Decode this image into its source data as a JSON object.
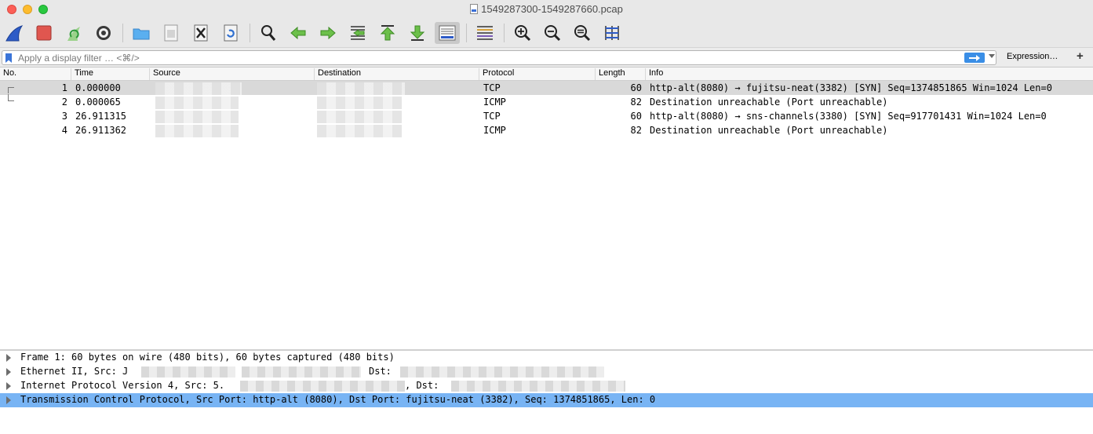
{
  "window": {
    "title": "1549287300-1549287660.pcap"
  },
  "toolbar": {
    "buttons": [
      {
        "icon": "shark-fin-icon",
        "label": "Start capture"
      },
      {
        "icon": "stop-icon",
        "label": "Stop capture"
      },
      {
        "icon": "restart-icon",
        "label": "Restart capture"
      },
      {
        "icon": "gear-icon",
        "label": "Capture options"
      },
      {
        "icon": "folder-icon",
        "label": "Open"
      },
      {
        "icon": "save-icon",
        "label": "Save"
      },
      {
        "icon": "close-file-icon",
        "label": "Close"
      },
      {
        "icon": "reload-icon",
        "label": "Reload"
      },
      {
        "icon": "search-icon",
        "label": "Find packet"
      },
      {
        "icon": "arrow-left-icon",
        "label": "Go back"
      },
      {
        "icon": "arrow-right-icon",
        "label": "Go forward"
      },
      {
        "icon": "go-to-packet-icon",
        "label": "Go to packet"
      },
      {
        "icon": "first-packet-icon",
        "label": "First packet"
      },
      {
        "icon": "last-packet-icon",
        "label": "Last packet"
      },
      {
        "icon": "autoscroll-icon",
        "label": "Auto scroll"
      },
      {
        "icon": "colorize-icon",
        "label": "Colorize"
      },
      {
        "icon": "zoom-in-icon",
        "label": "Zoom in"
      },
      {
        "icon": "zoom-out-icon",
        "label": "Zoom out"
      },
      {
        "icon": "zoom-reset-icon",
        "label": "Normal size"
      },
      {
        "icon": "resize-columns-icon",
        "label": "Resize columns"
      }
    ]
  },
  "filter": {
    "placeholder": "Apply a display filter … <⌘/>",
    "value": "",
    "apply_icon": "arrow-right-icon",
    "expression_label": "Expression…",
    "add_label": "+"
  },
  "packet_list": {
    "columns": [
      "No.",
      "Time",
      "Source",
      "Destination",
      "Protocol",
      "Length",
      "Info"
    ],
    "rows": [
      {
        "no": "1",
        "time": "0.000000",
        "protocol": "TCP",
        "length": "60",
        "info": "http-alt(8080) → fujitsu-neat(3382) [SYN] Seq=1374851865 Win=1024 Len=0",
        "selected": true
      },
      {
        "no": "2",
        "time": "0.000065",
        "protocol": "ICMP",
        "length": "82",
        "info": "Destination unreachable (Port unreachable)",
        "selected": false
      },
      {
        "no": "3",
        "time": "26.911315",
        "protocol": "TCP",
        "length": "60",
        "info": "http-alt(8080) → sns-channels(3380) [SYN] Seq=917701431 Win=1024 Len=0",
        "selected": false
      },
      {
        "no": "4",
        "time": "26.911362",
        "protocol": "ICMP",
        "length": "82",
        "info": "Destination unreachable (Port unreachable)",
        "selected": false
      }
    ]
  },
  "details": {
    "rows": [
      {
        "text": "Frame 1: 60 bytes on wire (480 bits), 60 bytes captured (480 bits)",
        "selected": false
      },
      {
        "text": "Ethernet II, Src: J",
        "text2": "Dst:",
        "selected": false
      },
      {
        "text": "Internet Protocol Version 4, Src: 5.",
        "text2": ", Dst:",
        "selected": false
      },
      {
        "text": "Transmission Control Protocol, Src Port: http-alt (8080), Dst Port: fujitsu-neat (3382), Seq: 1374851865, Len: 0",
        "selected": true
      }
    ]
  },
  "colors": {
    "selected_detail": "#78b4f4",
    "selected_row": "#d9d9d9",
    "accent": "#3a8ee6"
  }
}
